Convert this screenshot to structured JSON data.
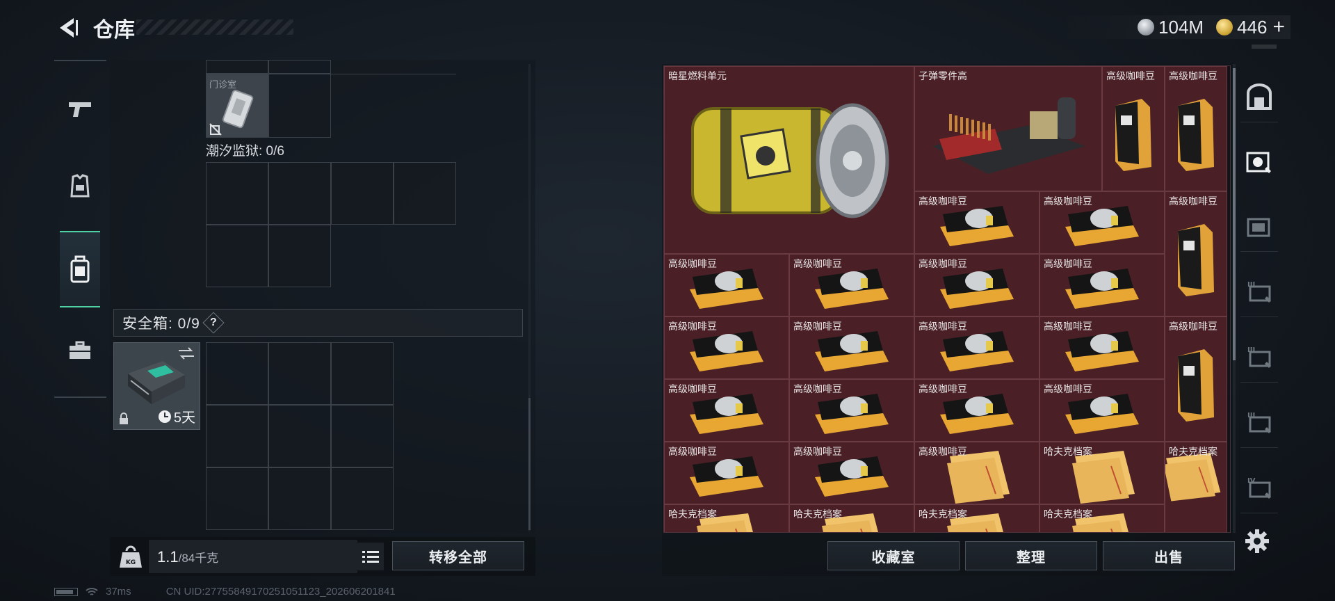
{
  "header": {
    "title": "仓库",
    "currencies": [
      {
        "icon": "silver-coin-icon",
        "value": "104M"
      },
      {
        "icon": "gold-coin-icon",
        "value": "446"
      }
    ],
    "plus_label": "+"
  },
  "sidebar": {
    "items": [
      {
        "name": "weapon-tab",
        "icon": "pistol-icon"
      },
      {
        "name": "armor-tab",
        "icon": "armor-vest-icon"
      },
      {
        "name": "backpack-tab",
        "icon": "backpack-icon",
        "active": true
      },
      {
        "name": "briefcase-tab",
        "icon": "briefcase-icon"
      }
    ]
  },
  "backpack": {
    "clinic_label": "门诊室",
    "prison_label": "潮汐监狱: 0/6",
    "safe_label": "安全箱: 0/9",
    "help": "?",
    "safe_timer": "5天",
    "weight_value": "1.1",
    "weight_max": "/84千克",
    "transfer_all": "转移全部"
  },
  "storage": {
    "items": [
      {
        "name": "暗星燃料单元"
      },
      {
        "name": "子弹零件高"
      },
      {
        "name": "高级咖啡豆"
      },
      {
        "name": "高级咖啡豆"
      },
      {
        "name": "高级咖啡豆"
      },
      {
        "name": "高级咖啡豆"
      },
      {
        "name": "高级咖啡豆"
      },
      {
        "name": "高级咖啡豆"
      },
      {
        "name": "高级咖啡豆"
      },
      {
        "name": "高级咖啡豆"
      },
      {
        "name": "高级咖啡豆"
      },
      {
        "name": "高级咖啡豆"
      },
      {
        "name": "高级咖啡豆"
      },
      {
        "name": "高级咖啡豆"
      },
      {
        "name": "高级咖啡豆"
      },
      {
        "name": "高级咖啡豆"
      },
      {
        "name": "高级咖啡豆"
      },
      {
        "name": "高级咖啡豆"
      },
      {
        "name": "高级咖啡豆"
      },
      {
        "name": "高级咖啡豆"
      },
      {
        "name": "高级咖啡豆"
      },
      {
        "name": "高级咖啡豆"
      },
      {
        "name": "高级咖啡豆"
      },
      {
        "name": "哈夫克档案"
      },
      {
        "name": "哈夫克档案"
      },
      {
        "name": "哈夫克档案"
      },
      {
        "name": "哈夫克档案"
      },
      {
        "name": "哈夫克档案"
      },
      {
        "name": "哈夫克档案"
      },
      {
        "name": "哈夫克档案"
      }
    ],
    "buttons": {
      "collection": "收藏室",
      "organize": "整理",
      "sell": "出售"
    },
    "right_tabs": [
      "all-tab",
      "ammo-case-tab",
      "folder-tab",
      "tier-III-tab-1",
      "tier-III-tab-2",
      "tier-III-tab-3",
      "tier-IV-tab"
    ],
    "tier_labels": {
      "t3a": "III",
      "t3b": "III",
      "t3c": "III",
      "t4": "IV"
    }
  },
  "status": {
    "ping": "37ms",
    "uid": "CN UID:2775584917025105​1123_202606201841"
  },
  "colors": {
    "accent": "#4fd2a4",
    "item_bg": "#4a2026"
  }
}
